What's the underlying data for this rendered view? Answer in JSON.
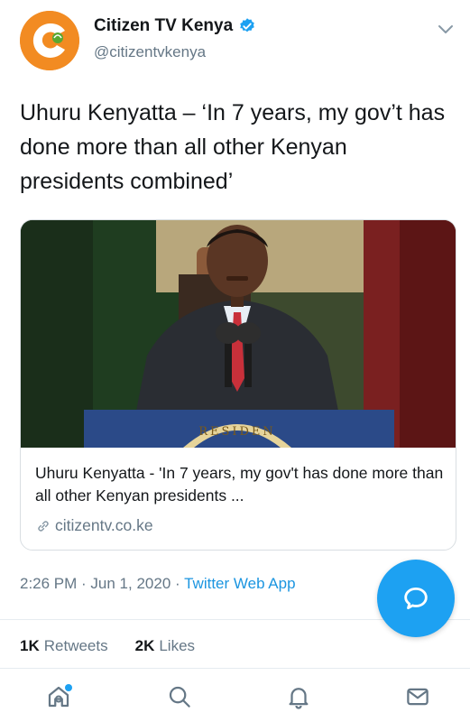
{
  "tweet": {
    "author": {
      "display_name": "Citizen TV Kenya",
      "handle": "@citizentvkenya",
      "verified": true
    },
    "text": "Uhuru Kenyatta – ‘In 7 years, my gov’t has done more than all other Kenyan presidents combined’",
    "card": {
      "title": "Uhuru Kenyatta - 'In 7 years, my gov't has done more than all other Kenyan presidents ...",
      "domain": "citizentv.co.ke",
      "podium_seal_text": "RESIDEN"
    },
    "time": "2:26 PM",
    "separator": " · ",
    "date": "Jun 1, 2020",
    "source": "Twitter Web App",
    "stats": {
      "retweets_count": "1K",
      "retweets_label": "Retweets",
      "likes_count": "2K",
      "likes_label": "Likes"
    }
  },
  "nav": {
    "items": [
      {
        "name": "home",
        "icon": "home-icon",
        "has_notification_dot": true
      },
      {
        "name": "search",
        "icon": "search-icon"
      },
      {
        "name": "notifications",
        "icon": "bell-icon"
      },
      {
        "name": "messages",
        "icon": "mail-icon"
      }
    ]
  },
  "colors": {
    "accent": "#1da1f2",
    "link": "#1b95e0",
    "secondary_text": "#657786",
    "primary_text": "#14171a",
    "brand_orange": "#f28b22"
  }
}
